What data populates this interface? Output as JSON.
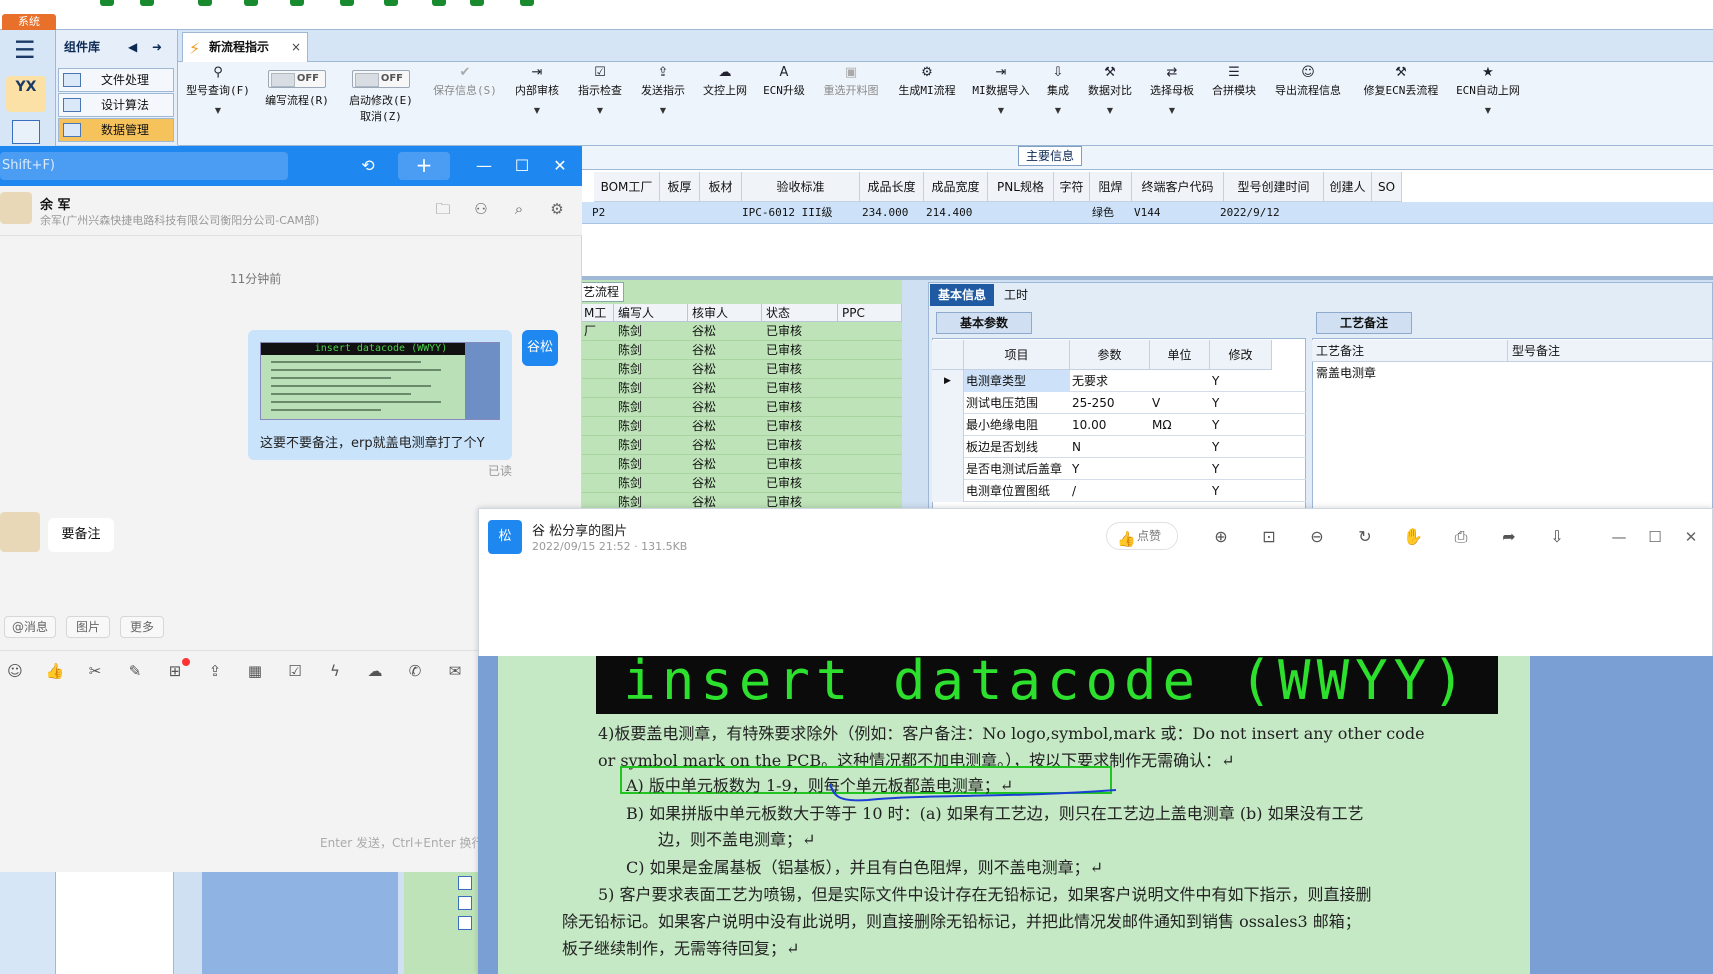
{
  "erp": {
    "system_tab": "系统",
    "component_lib": "组件库",
    "logo_text": "YX",
    "modules": [
      "文件处理",
      "设计算法",
      "数据管理"
    ],
    "open_tab": "新流程指示",
    "toolbar": {
      "query": "型号查询(F)",
      "write_flow": "编写流程(R)",
      "start_modify": "启动修改(E)",
      "cancel": "取消(Z)",
      "toggle_off": "OFF",
      "save_info": "保存信息(S)",
      "internal_review": "内部审核",
      "instruction_check": "指示检查",
      "send_instruction": "发送指示",
      "doc_upload": "文控上网",
      "ecn_upgrade": "ECN升级",
      "reselect_image": "重选开料图",
      "gen_mi_flow": "生成MI流程",
      "mi_import": "MI数据导入",
      "integrate": "集成",
      "data_compare": "数据对比",
      "select_mother": "选择母板",
      "merge_module": "合拼模块",
      "export_flow": "导出流程信息",
      "fix_ecn": "修复ECN丢流程",
      "ecn_auto_upload": "ECN自动上网"
    },
    "main_info_title": "主要信息",
    "main_grid": {
      "headers": [
        "BOM工厂",
        "板厚",
        "板材",
        "验收标准",
        "成品长度",
        "成品宽度",
        "PNL规格",
        "字符",
        "阻焊",
        "终端客户代码",
        "型号创建时间",
        "创建人",
        "SO"
      ],
      "row": {
        "factory": "P2",
        "standard": "IPC-6012 III级",
        "length": "234.000",
        "width": "214.400",
        "solder": "绿色",
        "customer": "V144",
        "created": "2022/9/12"
      }
    },
    "flow_tab": "艺流程",
    "flow_grid": {
      "headers": [
        "M工厂",
        "编写人",
        "核审人",
        "状态",
        "PPC"
      ],
      "rows": [
        {
          "writer": "陈剑",
          "reviewer": "谷松",
          "status": "已审核"
        },
        {
          "writer": "陈剑",
          "reviewer": "谷松",
          "status": "已审核"
        },
        {
          "writer": "陈剑",
          "reviewer": "谷松",
          "status": "已审核"
        },
        {
          "writer": "陈剑",
          "reviewer": "谷松",
          "status": "已审核"
        },
        {
          "writer": "陈剑",
          "reviewer": "谷松",
          "status": "已审核"
        },
        {
          "writer": "陈剑",
          "reviewer": "谷松",
          "status": "已审核"
        },
        {
          "writer": "陈剑",
          "reviewer": "谷松",
          "status": "已审核"
        },
        {
          "writer": "陈剑",
          "reviewer": "谷松",
          "status": "已审核"
        },
        {
          "writer": "陈剑",
          "reviewer": "谷松",
          "status": "已审核"
        },
        {
          "writer": "陈剑",
          "reviewer": "谷松",
          "status": "已审核"
        }
      ]
    },
    "basic_tabs": [
      "基本信息",
      "工时"
    ],
    "basic_param_title": "基本参数",
    "param_grid": {
      "headers": [
        "项目",
        "参数",
        "单位",
        "修改"
      ],
      "rows": [
        {
          "item": "电测章类型",
          "value": "无要求",
          "unit": "",
          "mod": "Y"
        },
        {
          "item": "测试电压范围",
          "value": "25-250",
          "unit": "V",
          "mod": "Y"
        },
        {
          "item": "最小绝缘电阻",
          "value": "10.00",
          "unit": "MΩ",
          "mod": "Y"
        },
        {
          "item": "板边是否划线",
          "value": "N",
          "unit": "",
          "mod": "Y"
        },
        {
          "item": "是否电测试后盖章",
          "value": "Y",
          "unit": "",
          "mod": "Y"
        },
        {
          "item": "电测章位置图纸",
          "value": "/",
          "unit": "",
          "mod": "Y"
        }
      ]
    },
    "craft_title": "工艺备注",
    "craft_grid": {
      "headers": [
        "工艺备注",
        "型号备注"
      ],
      "note": "需盖电测章"
    }
  },
  "chat": {
    "search_placeholder": "Shift+F)",
    "contact_name": "余 军",
    "contact_org": "余军(广州兴森快捷电路科技有限公司衡阳分公司-CAM部)",
    "time_label": "11分钟前",
    "self_message": "这要不要备注，erp就盖电测章打了个Y",
    "self_name": "谷松",
    "read_label": "已读",
    "peer_message": "要备注",
    "thumb_banner": "insert datacode (WWYY)",
    "input_tabs": [
      "@消息",
      "图片",
      "更多"
    ],
    "send_hint": "Enter 发送，Ctrl+Enter 换行"
  },
  "viewer": {
    "avatar_text": "松",
    "title": "谷 松分享的图片",
    "meta": "2022/09/15 21:52 · 131.5KB",
    "like_label": "点赞",
    "doc": {
      "banner": "insert datacode (WWYY)",
      "line1": "4)板要盖电测章，有特殊要求除外（例如：客户备注：No logo,symbol,mark 或：Do not insert any other code",
      "line2": "or symbol mark on the PCB。这种情况都不加电测章。），按以下要求制作无需确认：↵",
      "itemA": "A)  版中单元板数为 1-9，则每个单元板都盖电测章；↵",
      "itemB1": "B)  如果拼版中单元板数大于等于 10 时：(a) 如果有工艺边，则只在工艺边上盖电测章 (b) 如果没有工艺",
      "itemB2": "边，则不盖电测章；↵",
      "itemC": "C)  如果是金属基板（铝基板），并且有白色阻焊，则不盖电测章；↵",
      "item5a": "5)  客户要求表面工艺为喷锡，但是实际文件中设计存在无铅标记，如果客户说明文件中有如下指示，则直接删",
      "item5b": "除无铅标记。如果客户说明中没有此说明，则直接删除无铅标记，并把此情况发邮件通知到销售 ossales3 邮箱；",
      "item5c": "板子继续制作，无需等待回复；↵"
    }
  }
}
